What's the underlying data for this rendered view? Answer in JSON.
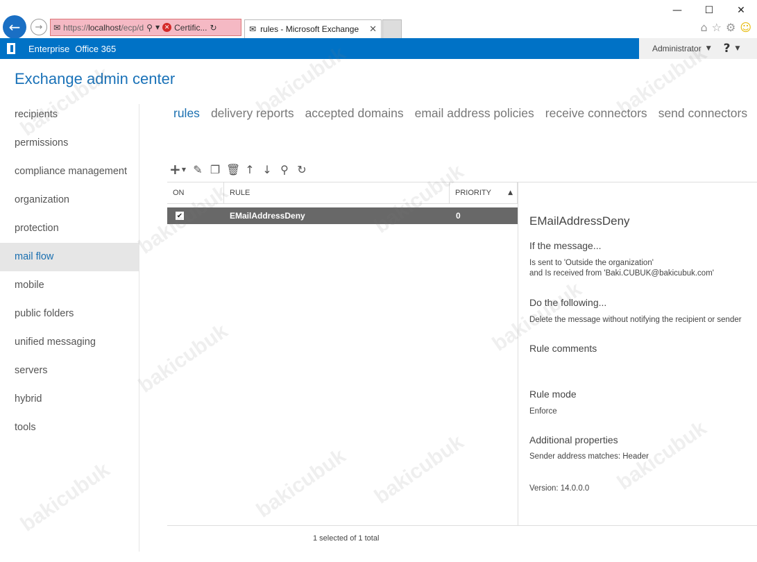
{
  "browser": {
    "window_controls": {
      "minimize": "—",
      "maximize": "☐",
      "close": "✕"
    },
    "address": {
      "url_prefix": "https://",
      "url_host": "localhost",
      "url_path": "/ecp/d",
      "cert_label": "Certific..."
    },
    "tab": {
      "title": "rules - Microsoft Exchange",
      "close": "✕"
    }
  },
  "topbar": {
    "links": [
      "Enterprise",
      "Office 365"
    ],
    "user": "Administrator",
    "help": "?"
  },
  "app_title": "Exchange admin center",
  "leftnav": {
    "items": [
      {
        "label": "recipients"
      },
      {
        "label": "permissions"
      },
      {
        "label": "compliance management"
      },
      {
        "label": "organization"
      },
      {
        "label": "protection"
      },
      {
        "label": "mail flow"
      },
      {
        "label": "mobile"
      },
      {
        "label": "public folders"
      },
      {
        "label": "unified messaging"
      },
      {
        "label": "servers"
      },
      {
        "label": "hybrid"
      },
      {
        "label": "tools"
      }
    ],
    "active_index": 5
  },
  "subtabs": [
    {
      "label": "rules"
    },
    {
      "label": "delivery reports"
    },
    {
      "label": "accepted domains"
    },
    {
      "label": "email address policies"
    },
    {
      "label": "receive connectors"
    },
    {
      "label": "send connectors"
    }
  ],
  "grid": {
    "headers": {
      "on": "ON",
      "rule": "RULE",
      "priority": "PRIORITY"
    },
    "rows": [
      {
        "on": true,
        "rule": "EMailAddressDeny",
        "priority": "0"
      }
    ],
    "footer": "1 selected of 1 total"
  },
  "details": {
    "title": "EMailAddressDeny",
    "if_heading": "If the message...",
    "if_line1": "Is sent to 'Outside the organization'",
    "if_line2": "and Is received from 'Baki.CUBUK@bakicubuk.com'",
    "do_heading": "Do the following...",
    "do_line1": "Delete the message without notifying the recipient or sender",
    "comments_heading": "Rule comments",
    "mode_heading": "Rule mode",
    "mode_value": "Enforce",
    "props_heading": "Additional properties",
    "props_value": "Sender address matches: Header",
    "version": "Version: 14.0.0.0"
  },
  "watermark": "bakicubuk"
}
